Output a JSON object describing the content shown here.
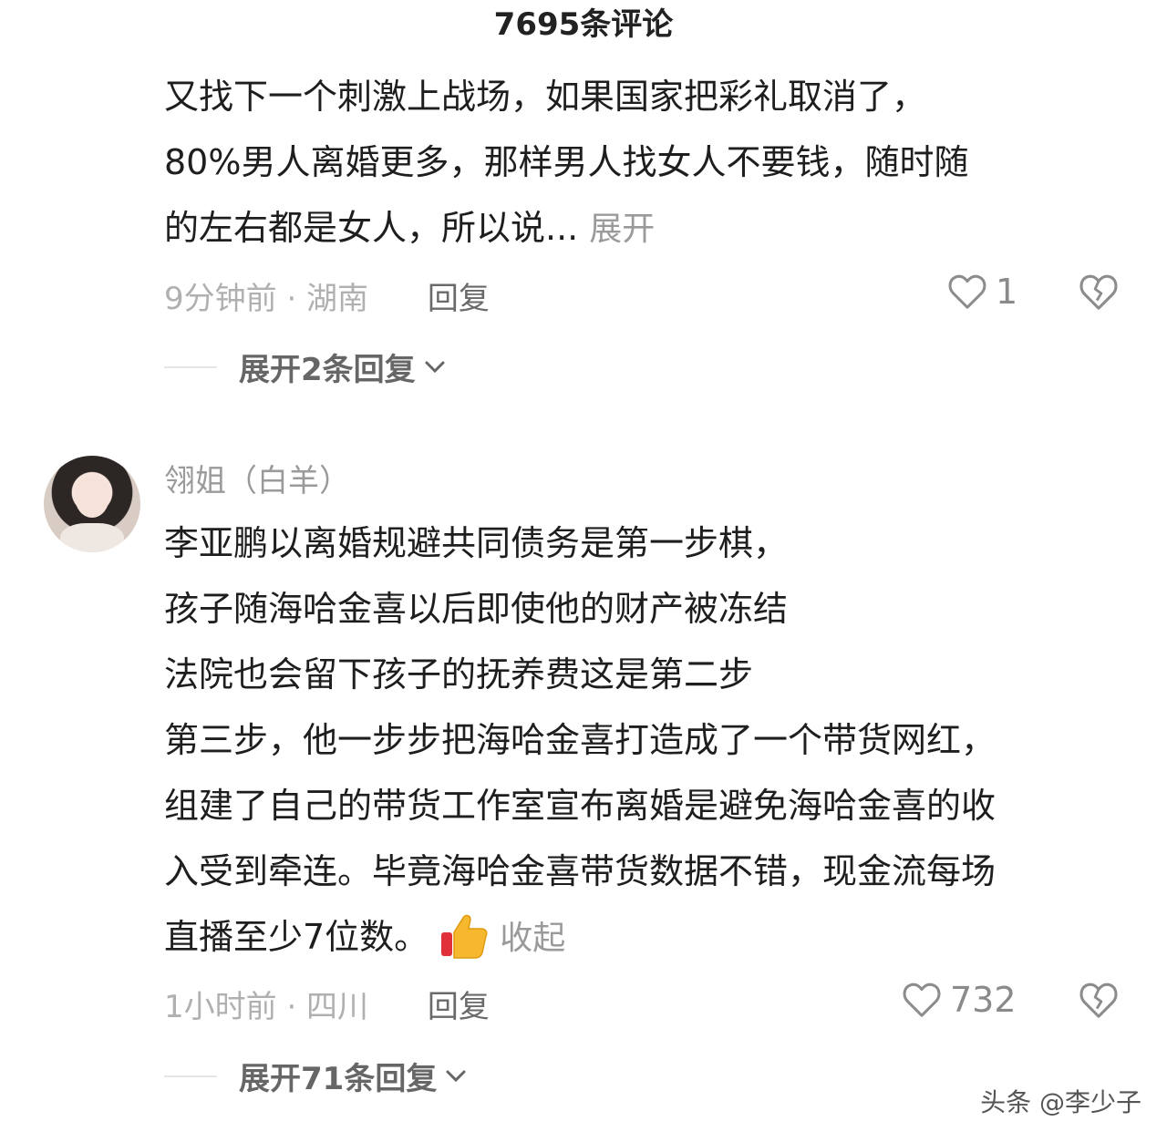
{
  "header": {
    "title": "7695条评论"
  },
  "comment1": {
    "partial_top_line": "又找下一个刺激上战场，如果国家把彩礼取消了，",
    "lines": [
      "80%男人离婚更多，那样男人找女人不要钱，随时随",
      "的左右都是女人，所以说..."
    ],
    "expand_label": "展开",
    "time_location": "9分钟前 · 湖南",
    "reply_label": "回复",
    "like_count": "1",
    "replies_label": "展开2条回复"
  },
  "comment2": {
    "username": "翎姐（白羊）",
    "lines": [
      "李亚鹏以离婚规避共同债务是第一步棋，",
      "孩子随海哈金喜以后即使他的财产被冻结",
      "法院也会留下孩子的抚养费这是第二步",
      "第三步，他一步步把海哈金喜打造成了一个带货网红，",
      "组建了自己的带货工作室宣布离婚是避免海哈金喜的收",
      "入受到牵连。毕竟海哈金喜带货数据不错，现金流每场",
      "直播至少7位数。"
    ],
    "collapse_label": "收起",
    "time_location": "1小时前 · 四川",
    "reply_label": "回复",
    "like_count": "732",
    "replies_label": "展开71条回复"
  },
  "watermark": "头条 @李少子",
  "colors": {
    "text": "#1e1e1e",
    "muted": "#b0b0b0",
    "link": "#9a9a9a",
    "emoji": "#f5b82e"
  }
}
